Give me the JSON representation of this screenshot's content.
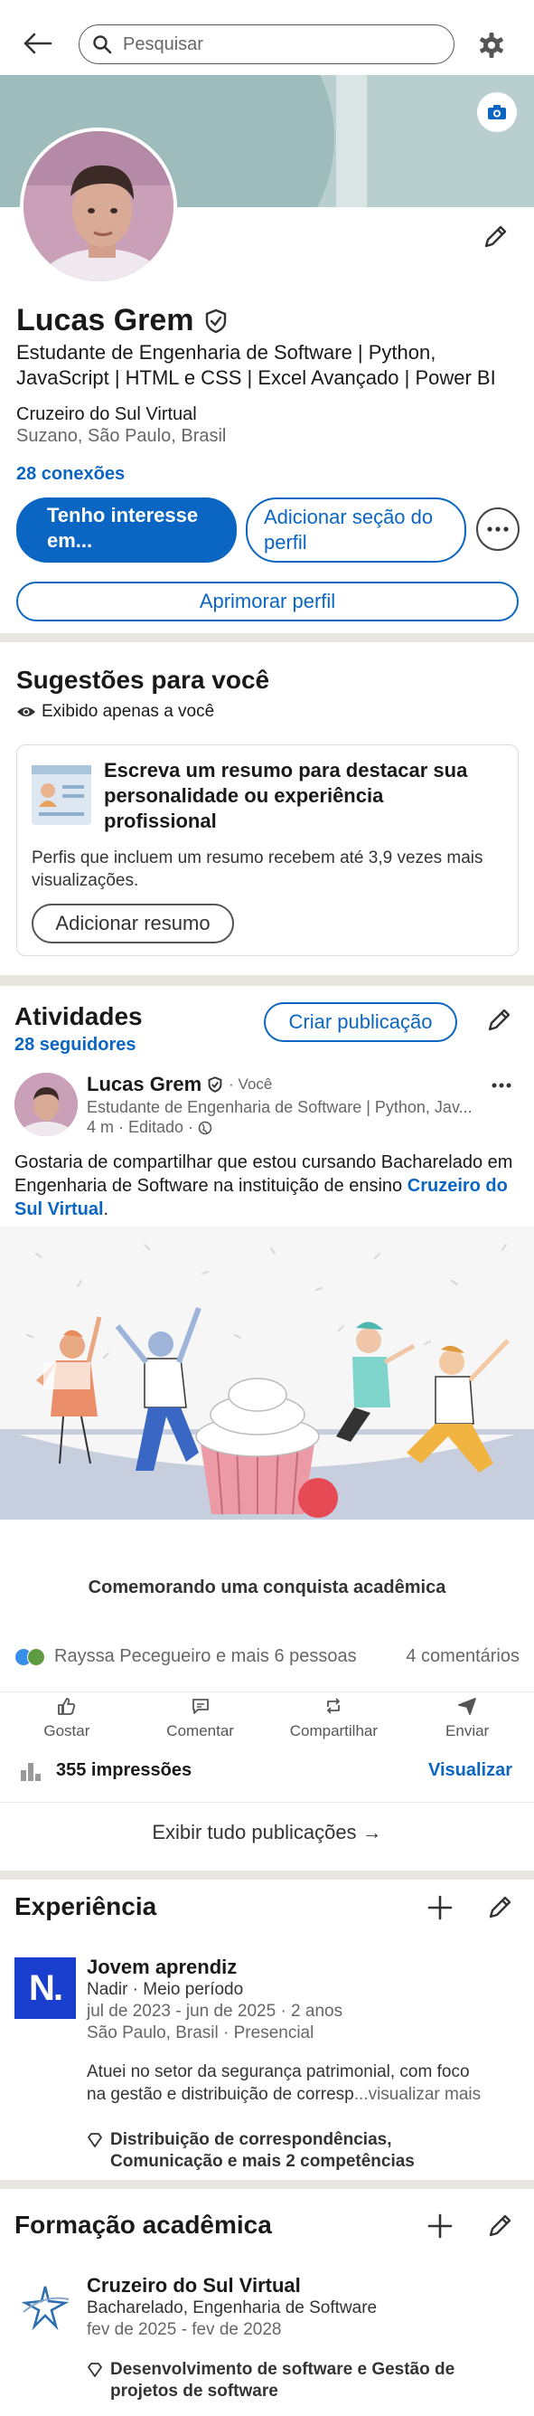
{
  "topbar": {
    "search_placeholder": "Pesquisar"
  },
  "profile": {
    "name": "Lucas Grem",
    "headline": "Estudante de Engenharia de Software | Python, JavaScript | HTML e CSS | Excel Avançado | Power BI",
    "school": "Cruzeiro do Sul Virtual",
    "location": "Suzano, São Paulo, Brasil",
    "connections": "28 conexões",
    "btn_interest": "Tenho interesse em...",
    "btn_add_section": "Adicionar seção do perfil",
    "btn_improve": "Aprimorar perfil"
  },
  "suggestions": {
    "title": "Sugestões para você",
    "visibility": "Exibido apenas a você",
    "card_title": "Escreva um resumo para destacar sua personalidade ou experiência profissional",
    "card_text": "Perfis que incluem um resumo recebem até 3,9 vezes mais visualizações.",
    "card_button": "Adicionar resumo"
  },
  "activity": {
    "title": "Atividades",
    "followers": "28 seguidores",
    "create_post": "Criar publicação",
    "post": {
      "author": "Lucas Grem",
      "degree": "· Você",
      "author_headline": "Estudante de Engenharia de Software | Python, Jav...",
      "meta": "4 m · Editado ·",
      "text_before": "Gostaria de compartilhar que estou cursando Bacharelado em Engenharia de Software na instituição de ensino ",
      "text_link": "Cruzeiro do Sul Virtual",
      "text_after": ".",
      "image_caption": "Comemorando uma conquista acadêmica",
      "reactions": "Rayssa Pecegueiro e mais 6 pessoas",
      "comments": "4 comentários"
    },
    "actions": [
      "Gostar",
      "Comentar",
      "Compartilhar",
      "Enviar"
    ],
    "impressions": "355 impressões",
    "view": "Visualizar",
    "show_all": "Exibir tudo publicações →"
  },
  "experience": {
    "title": "Experiência",
    "role": "Jovem aprendiz",
    "company": "Nadir · Meio período",
    "dates": "jul de 2023 - jun de 2025 · 2 anos",
    "place": "São Paulo, Brasil · Presencial",
    "desc_line1": "Atuei no setor da segurança patrimonial, com foco",
    "desc_line2": "na gestão e distribuição de corresp",
    "see_more": "...visualizar mais",
    "skills": "Distribuição de correspondências, Comunicação e mais 2 competências",
    "logo_letter": "N."
  },
  "education": {
    "title": "Formação acadêmica",
    "school": "Cruzeiro do Sul Virtual",
    "degree": "Bacharelado, Engenharia de Software",
    "dates": "fev de 2025 - fev de 2028",
    "skills": "Desenvolvimento de software e Gestão de projetos de software"
  },
  "colors": {
    "accent": "#0a66c2",
    "logo_bg": "#1a3fce",
    "cover": "#b9cfcf"
  }
}
